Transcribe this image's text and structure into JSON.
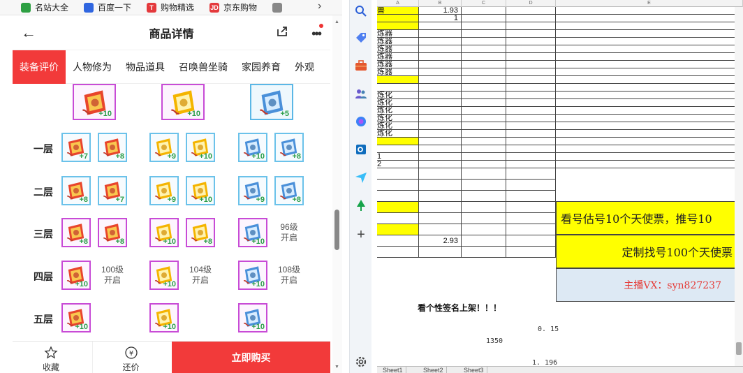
{
  "bookmarks": [
    {
      "label": "名站大全",
      "icon": "star-icon",
      "color": "#2ea043"
    },
    {
      "label": "百度一下",
      "icon": "paw-icon",
      "color": "#3066e0"
    },
    {
      "label": "购物精选",
      "icon": "t-icon",
      "color": "#e4393c",
      "glyph": "T"
    },
    {
      "label": "京东购物",
      "icon": "jd-icon",
      "color": "#e4393c",
      "glyph": "JD"
    },
    {
      "label": "",
      "icon": "document-icon",
      "color": "#888"
    }
  ],
  "phone": {
    "title": "商品详情",
    "tabs": [
      "装备评价",
      "人物修为",
      "物品道具",
      "召唤兽坐骑",
      "家园养育",
      "外观"
    ],
    "active_tab": 0,
    "big_items": [
      {
        "level": "+10",
        "style": "purple"
      },
      {
        "level": "+10",
        "style": "purple"
      },
      {
        "level": "+5",
        "style": "blue"
      }
    ],
    "rows": [
      {
        "label": "一层",
        "slots": [
          {
            "level": "+7",
            "style": "blue",
            "color": "red"
          },
          {
            "level": "+8",
            "style": "blue",
            "color": "red"
          },
          {
            "level": "+9",
            "style": "blue",
            "color": "gold"
          },
          {
            "level": "+10",
            "style": "blue",
            "color": "gold"
          },
          {
            "level": "+10",
            "style": "blue",
            "color": "blue"
          },
          {
            "level": "+8",
            "style": "blue",
            "color": "blue"
          }
        ]
      },
      {
        "label": "二层",
        "slots": [
          {
            "level": "+8",
            "style": "blue",
            "color": "red"
          },
          {
            "level": "+7",
            "style": "blue",
            "color": "red"
          },
          {
            "level": "+9",
            "style": "blue",
            "color": "gold"
          },
          {
            "level": "+10",
            "style": "blue",
            "color": "gold"
          },
          {
            "level": "+9",
            "style": "blue",
            "color": "blue"
          },
          {
            "level": "+8",
            "style": "blue",
            "color": "blue"
          }
        ]
      },
      {
        "label": "三层",
        "slots": [
          {
            "level": "+8",
            "style": "purple",
            "color": "red"
          },
          {
            "level": "+8",
            "style": "purple",
            "color": "red"
          },
          {
            "level": "+10",
            "style": "purple",
            "color": "gold"
          },
          {
            "level": "+8",
            "style": "purple",
            "color": "gold"
          },
          {
            "level": "+10",
            "style": "purple",
            "color": "blue"
          },
          {
            "locked": "96级\n开启"
          }
        ]
      },
      {
        "label": "四层",
        "slots": [
          {
            "level": "+10",
            "style": "purple",
            "color": "red"
          },
          {
            "locked": "100级\n开启"
          },
          {
            "level": "+10",
            "style": "purple",
            "color": "gold"
          },
          {
            "locked": "104级\n开启"
          },
          {
            "level": "+10",
            "style": "purple",
            "color": "blue"
          },
          {
            "locked": "108级\n开启"
          }
        ]
      },
      {
        "label": "五层",
        "slots": [
          {
            "level": "+10",
            "style": "purple",
            "color": "red"
          },
          null,
          {
            "level": "+10",
            "style": "purple",
            "color": "gold"
          },
          null,
          {
            "level": "+10",
            "style": "purple",
            "color": "blue"
          },
          null
        ]
      }
    ],
    "bottom": {
      "favorite": "收藏",
      "bargain": "还价",
      "buy": "立即购买"
    }
  },
  "sheet": {
    "columns": [
      "A",
      "B",
      "C",
      "D",
      "E"
    ],
    "rows": [
      {
        "a": "兽",
        "b": "1.93",
        "a_yellow": true,
        "b_yellow": false
      },
      {
        "a": "",
        "b": "1",
        "a_yellow": true
      },
      {
        "a": "",
        "b": "",
        "a_yellow": true
      },
      {
        "a": "炼器",
        "b": ""
      },
      {
        "a": "炼器",
        "b": ""
      },
      {
        "a": "炼器",
        "b": ""
      },
      {
        "a": "炼器",
        "b": ""
      },
      {
        "a": "炼器",
        "b": ""
      },
      {
        "a": "炼器",
        "b": ""
      },
      {
        "a": "",
        "b": "",
        "a_yellow": true
      },
      {
        "a": "",
        "b": ""
      },
      {
        "a": "炼化",
        "b": ""
      },
      {
        "a": "炼化",
        "b": ""
      },
      {
        "a": "炼化",
        "b": ""
      },
      {
        "a": "炼化",
        "b": ""
      },
      {
        "a": "炼化",
        "b": ""
      },
      {
        "a": "炼化",
        "b": ""
      },
      {
        "a": "",
        "b": "",
        "a_yellow": true
      },
      {
        "a": "",
        "b": ""
      },
      {
        "a": "1",
        "b": ""
      },
      {
        "a": "2",
        "b": ""
      }
    ],
    "lower_b": "2.93",
    "banner1": "看号估号10个天使票，推号10",
    "banner2": "定制找号100个天使票",
    "banner3": "主播VX：syn827237",
    "note": "看个性签名上架！！！",
    "floats": [
      "0. 15",
      "1350",
      "1. 196"
    ],
    "tabs": [
      "Sheet1",
      "Sheet2",
      "Sheet3"
    ]
  },
  "colors": {
    "accent": "#f23a3a",
    "yellow": "#ffff00",
    "banner3_bg": "#dde9f4",
    "banner3_text": "#e53935"
  }
}
